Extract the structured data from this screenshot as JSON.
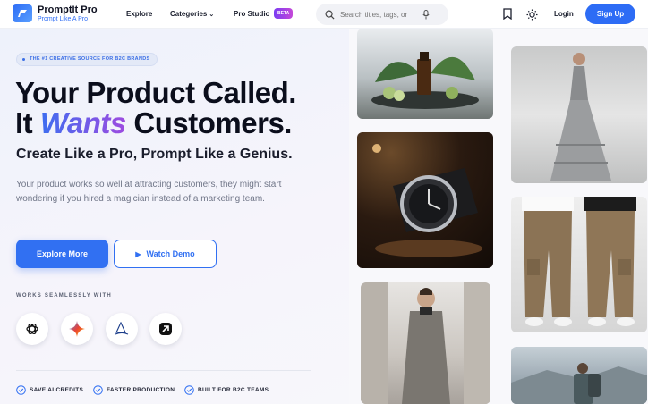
{
  "nav": {
    "logo_title": "PromptIt Pro",
    "logo_sub": "Prompt Like A Pro",
    "explore": "Explore",
    "categories": "Categories",
    "pro_studio": "Pro Studio",
    "beta": "BETA",
    "search_placeholder": "Search titles, tags, or",
    "login": "Login",
    "signup": "Sign Up"
  },
  "hero": {
    "badge": "THE #1 CREATIVE SOURCE FOR B2C BRANDS",
    "title_line1": "Your Product Called.",
    "title_it": "It",
    "title_wants": "Wants",
    "title_customers": "Customers.",
    "subtitle": "Create Like a Pro, Prompt Like a Genius.",
    "description": "Your product works so well at attracting customers, they might start wondering if you hired a magician instead of a marketing team.",
    "explore_button": "Explore More",
    "demo_button": "Watch Demo",
    "works_with": "WORKS SEAMLESSLY WITH",
    "tools": [
      "chatgpt-icon",
      "gemini-icon",
      "midjourney-icon",
      "runway-icon"
    ],
    "features": [
      "SAVE AI CREDITS",
      "FASTER PRODUCTION",
      "BUILT FOR B2C TEAMS"
    ]
  },
  "gallery": {
    "images": [
      "skincare-product-image",
      "wristwatch-image",
      "gown-model-image",
      "cargo-pants-image",
      "overcoat-model-image",
      "hiker-backpack-image"
    ]
  },
  "colors": {
    "accent": "#3170f2",
    "gradient_start": "#3d6ef0",
    "gradient_end": "#9e4be0",
    "beta_start": "#7b3cf2",
    "beta_end": "#c548d8"
  }
}
